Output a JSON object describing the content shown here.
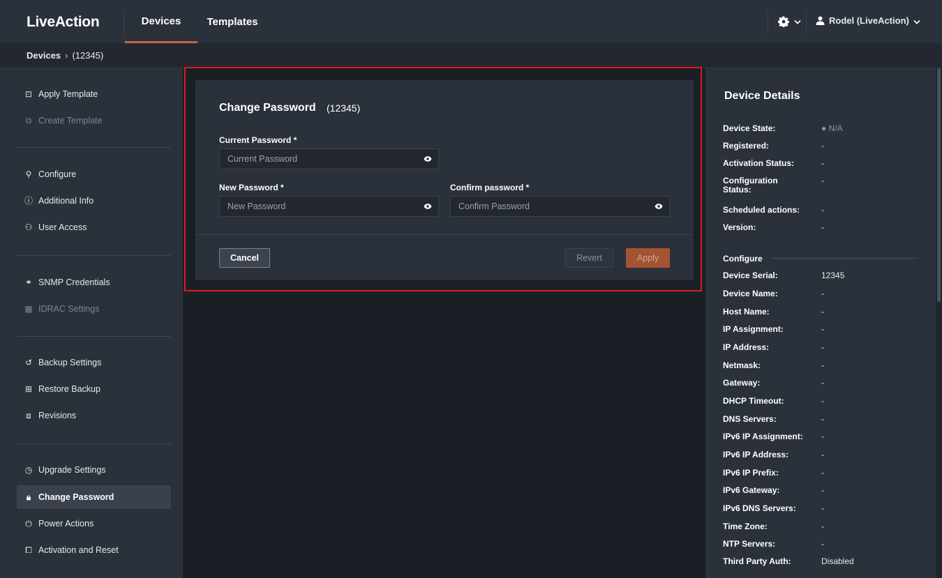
{
  "brand": "LiveAction",
  "nav": {
    "tabs": [
      "Devices",
      "Templates"
    ],
    "active_tab": "Devices"
  },
  "user": {
    "name": "Rodel (LiveAction)"
  },
  "icons": {
    "settings": "gear-icon",
    "user": "user-icon",
    "dropdown": "chevron-down-icon",
    "password_toggle": "eye-icon"
  },
  "breadcrumb": {
    "root": "Devices",
    "current": "(12345)"
  },
  "sidebar": {
    "items": [
      {
        "label": "Apply Template",
        "icon": "template-apply-icon",
        "disabled": false
      },
      {
        "label": "Create Template",
        "icon": "template-create-icon",
        "disabled": true
      },
      {
        "label": "Configure",
        "icon": "wrench-icon",
        "disabled": false
      },
      {
        "label": "Additional Info",
        "icon": "info-icon",
        "disabled": false
      },
      {
        "label": "User Access",
        "icon": "user-access-icon",
        "disabled": false
      },
      {
        "label": "SNMP Credentials",
        "icon": "network-icon",
        "disabled": false
      },
      {
        "label": "IDRAC Settings",
        "icon": "server-icon",
        "disabled": true
      },
      {
        "label": "Backup Settings",
        "icon": "history-icon",
        "disabled": false
      },
      {
        "label": "Restore Backup",
        "icon": "restore-icon",
        "disabled": false
      },
      {
        "label": "Revisions",
        "icon": "revisions-icon",
        "disabled": false
      },
      {
        "label": "Upgrade Settings",
        "icon": "clock-icon",
        "disabled": false
      },
      {
        "label": "Change Password",
        "icon": "lock-icon",
        "disabled": false,
        "active": true
      },
      {
        "label": "Power Actions",
        "icon": "power-icon",
        "disabled": false
      },
      {
        "label": "Activation and Reset",
        "icon": "reset-icon",
        "disabled": false
      }
    ]
  },
  "form": {
    "title": "Change Password",
    "subtitle": "(12345)",
    "current_password": {
      "label": "Current Password *",
      "placeholder": "Current Password",
      "value": ""
    },
    "new_password": {
      "label": "New Password *",
      "placeholder": "New Password",
      "value": ""
    },
    "confirm_password": {
      "label": "Confirm password *",
      "placeholder": "Confirm Password",
      "value": ""
    },
    "buttons": {
      "cancel": "Cancel",
      "revert": "Revert",
      "apply": "Apply"
    }
  },
  "details": {
    "title": "Device Details",
    "state": {
      "label": "Device State:",
      "value": "● N/A"
    },
    "rows": [
      {
        "label": "Registered:",
        "value": "-"
      },
      {
        "label": "Activation Status:",
        "value": "-"
      },
      {
        "label": "Configuration Status:",
        "value": "-"
      },
      {
        "label": "Scheduled actions:",
        "value": "-"
      },
      {
        "label": "Version:",
        "value": "-"
      }
    ],
    "configure_title": "Configure",
    "configure": [
      {
        "label": "Device Serial:",
        "value": "12345"
      },
      {
        "label": "Device Name:",
        "value": "-"
      },
      {
        "label": "Host Name:",
        "value": "-"
      },
      {
        "label": "IP Assignment:",
        "value": "-"
      },
      {
        "label": "IP Address:",
        "value": "-"
      },
      {
        "label": "Netmask:",
        "value": "-"
      },
      {
        "label": "Gateway:",
        "value": "-"
      },
      {
        "label": "DHCP Timeout:",
        "value": "-"
      },
      {
        "label": "DNS Servers:",
        "value": "-"
      },
      {
        "label": "IPv6 IP Assignment:",
        "value": "-"
      },
      {
        "label": "IPv6 IP Address:",
        "value": "-"
      },
      {
        "label": "IPv6 IP Prefix:",
        "value": "-"
      },
      {
        "label": "IPv6 Gateway:",
        "value": "-"
      },
      {
        "label": "IPv6 DNS Servers:",
        "value": "-"
      },
      {
        "label": "Time Zone:",
        "value": "-"
      },
      {
        "label": "NTP Servers:",
        "value": "-"
      },
      {
        "label": "Third Party Auth:",
        "value": "Disabled"
      }
    ]
  },
  "colors": {
    "accent": "#c7653a",
    "apply_button": "#a35432",
    "highlight_box": "#e0191b",
    "panel": "#2b313b",
    "background": "#1a1f26"
  }
}
